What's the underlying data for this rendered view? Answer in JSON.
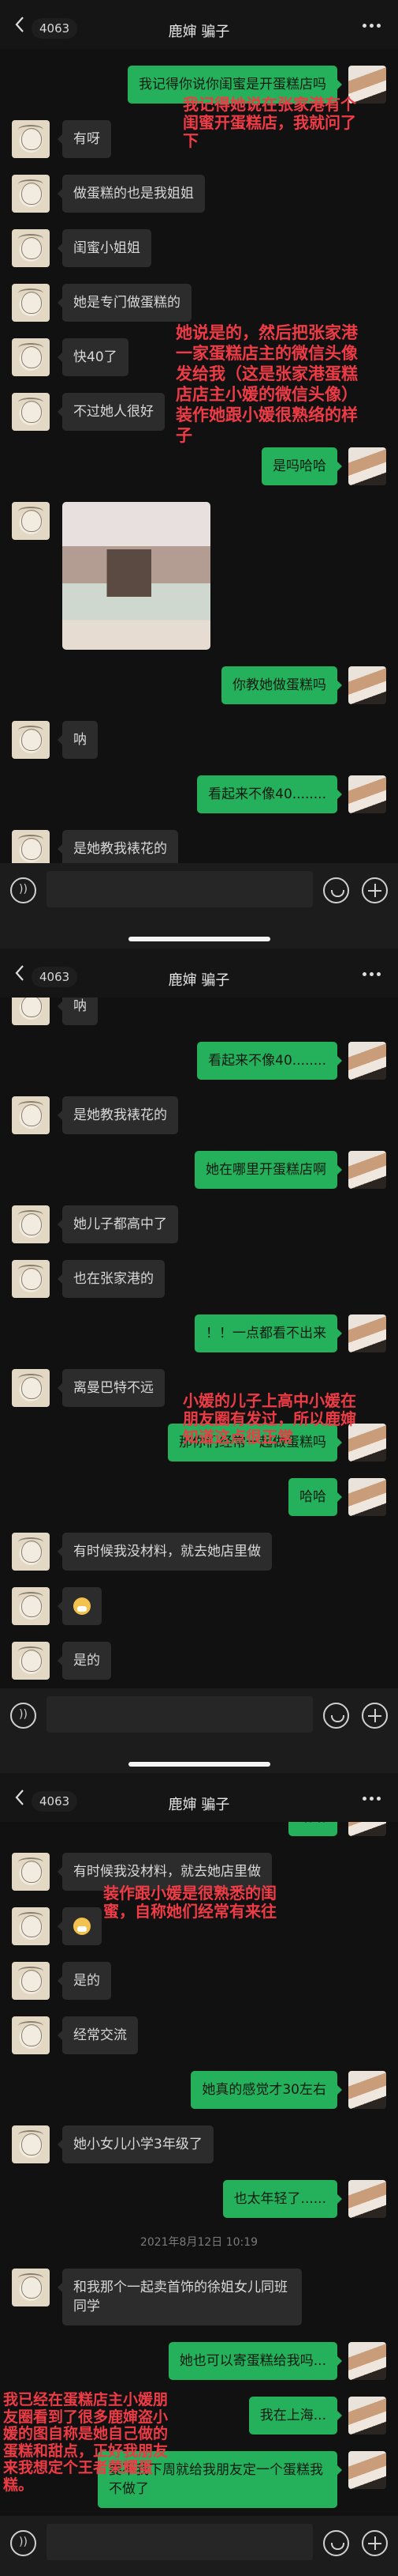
{
  "header": {
    "unread_count": "4063",
    "title": "鹿婶 骗子"
  },
  "colors": {
    "background": "#111111",
    "sent_bubble": "#25b05b",
    "received_bubble": "#2c2c2c",
    "annotation": "#ee3b45"
  },
  "icons": {
    "back": "chevron-left-icon",
    "more": "more-dots-icon",
    "voice": "voice-icon",
    "emoji": "emoji-icon",
    "plus": "plus-icon",
    "sticker": "doge-emoji"
  },
  "screens": [
    {
      "messages": [
        {
          "from": "me",
          "text": "我记得你说你闺蜜是开蛋糕店吗"
        },
        {
          "from": "them",
          "text": "有呀"
        },
        {
          "from": "them",
          "text": "做蛋糕的也是我姐姐"
        },
        {
          "from": "them",
          "text": "闺蜜小姐姐"
        },
        {
          "from": "them",
          "text": "她是专门做蛋糕的"
        },
        {
          "from": "them",
          "text": "快40了"
        },
        {
          "from": "them",
          "text": "不过她人很好"
        },
        {
          "from": "me",
          "text": "是吗哈哈"
        },
        {
          "from": "them",
          "type": "image"
        },
        {
          "from": "me",
          "text": "你教她做蛋糕吗"
        },
        {
          "from": "them",
          "text": "呐"
        },
        {
          "from": "me",
          "text": "看起来不像40........"
        },
        {
          "from": "them",
          "text": "是她教我裱花的"
        }
      ]
    },
    {
      "messages": [
        {
          "from": "them",
          "text": "呐"
        },
        {
          "from": "me",
          "text": "看起来不像40........"
        },
        {
          "from": "them",
          "text": "是她教我裱花的"
        },
        {
          "from": "me",
          "text": "她在哪里开蛋糕店啊"
        },
        {
          "from": "them",
          "text": "她儿子都高中了"
        },
        {
          "from": "them",
          "text": "也在张家港的"
        },
        {
          "from": "me",
          "text": "！！一点都看不出来"
        },
        {
          "from": "them",
          "text": "离曼巴特不远"
        },
        {
          "from": "me",
          "text": "那你们经常一起做蛋糕吗"
        },
        {
          "from": "me",
          "text": "哈哈"
        },
        {
          "from": "them",
          "text": "有时候我没材料，就去她店里做"
        },
        {
          "from": "them",
          "type": "emoji"
        },
        {
          "from": "them",
          "text": "是的"
        }
      ]
    },
    {
      "messages": [
        {
          "from": "me",
          "text": "哈哈"
        },
        {
          "from": "them",
          "text": "有时候我没材料，就去她店里做"
        },
        {
          "from": "them",
          "type": "emoji"
        },
        {
          "from": "them",
          "text": "是的"
        },
        {
          "from": "them",
          "text": "经常交流"
        },
        {
          "from": "me",
          "text": "她真的感觉才30左右"
        },
        {
          "from": "them",
          "text": "她小女儿小学3年级了"
        },
        {
          "from": "me",
          "text": "也太年轻了......"
        },
        {
          "type": "time",
          "text": "2021年8月12日 10:19"
        },
        {
          "from": "them",
          "text": "和我那个一起卖首饰的徐姐女儿同班同学"
        },
        {
          "from": "me",
          "text": "她也可以寄蛋糕给我吗..."
        },
        {
          "from": "me",
          "text": "我在上海..."
        },
        {
          "from": "me",
          "text": "要不我下周就给我朋友定一个蛋糕我不做了"
        }
      ]
    }
  ],
  "annotations": [
    {
      "lines": [
        "我记得她说在张家港有个",
        "闺蜜开蛋糕店，我就问了",
        "下"
      ]
    },
    {
      "lines": [
        "她说是的，然后把张家港",
        "一家蛋糕店主的微信头像",
        "发给我（这是张家港蛋糕",
        "店店主小媛的微信头像）",
        "装作她跟小媛很熟络的样",
        "子"
      ]
    },
    {
      "lines": [
        "小媛的儿子上高中小媛在",
        "朋友圈有发过，所以鹿婶",
        "知道这点很正常"
      ]
    },
    {
      "lines": [
        "装作跟小媛是很熟悉的闺",
        "蜜，自称她们经常有来往"
      ]
    },
    {
      "lines": [
        "我已经在蛋糕店主小媛朋",
        "友圈看到了很多鹿婶盗小",
        "媛的图自称是她自己做的",
        "蛋糕和甜点，正好我朋友",
        "来我想定个王者荣耀蛋",
        "糕。"
      ]
    }
  ]
}
